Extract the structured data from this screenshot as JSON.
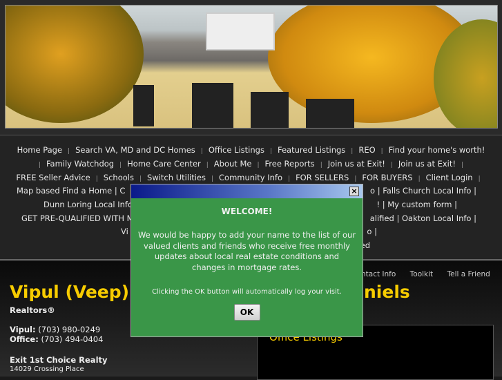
{
  "nav": {
    "line1": [
      "Home Page",
      "Search VA, MD and DC Homes",
      "Office Listings",
      "Featured Listings",
      "REO",
      "Find your home's worth!"
    ],
    "line2": [
      "Family Watchdog",
      "Home Care Center",
      "About Me",
      "Free Reports",
      "Join us at Exit!",
      "Join us at Exit!"
    ],
    "line3": [
      "FREE Seller Advice",
      "Schools",
      "Switch Utilities",
      "Community Info",
      "FOR SELLERS",
      "FOR BUYERS",
      "Client Login"
    ],
    "line4_left": "Map based Find a Home  |  C",
    "line4_right": "o  |  Falls Church Local Info  |",
    "line5_left": "Dunn Loring Local Info",
    "line5_right": "!  |  My custom form  |",
    "line6_left": "GET PRE-QUALIFIED WITH MA",
    "line6_right": "alified  |  Oakton Local Info  |",
    "line7_left": "Vi",
    "line7_right": "o  |",
    "line8_right": "ed"
  },
  "toplinks": [
    "ntact Info",
    "Toolkit",
    "Tell a Friend"
  ],
  "agent": {
    "name_left": "Vipul (Veep)",
    "name_right": "niels",
    "subtitle": "Realtors®",
    "phone_label": "Vipul:",
    "phone": "(703) 980-0249",
    "office_label": "Office:",
    "office": "(703) 494-0404",
    "company": "Exit 1st Choice Realty",
    "address": "14029 Crossing Place"
  },
  "listings": {
    "title": "Office Listings"
  },
  "modal": {
    "close": "×",
    "title": "WELCOME!",
    "text": "We would be happy to add your name to the list of our valued clients and friends who receive free monthly updates about local real estate conditions and changes in mortgage rates.",
    "note": "Clicking the OK button will automatically log your visit.",
    "ok": "OK"
  },
  "colors": {
    "accent": "#f7cc00",
    "modal_bg": "#3a9648"
  }
}
